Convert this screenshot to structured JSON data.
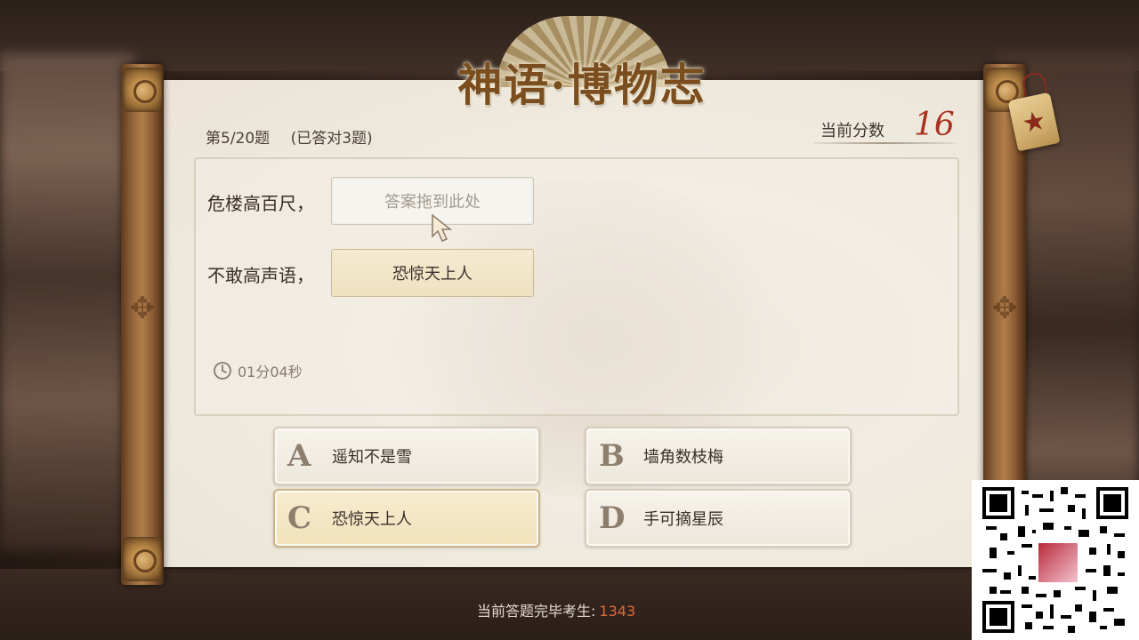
{
  "header": {
    "title": "神语·博物志",
    "progress": "第5/20题",
    "answered": "(已答对3题)",
    "score_label": "当前分数",
    "score_value": "16"
  },
  "question": {
    "line1_prefix": "危楼高百尺，",
    "line1_slot_placeholder": "答案拖到此处",
    "line2_prefix": "不敢高声语，",
    "line2_answer": "恐惊天上人",
    "timer": "01分04秒"
  },
  "options": [
    {
      "letter": "A",
      "text": "遥知不是雪"
    },
    {
      "letter": "B",
      "text": "墙角数枝梅"
    },
    {
      "letter": "C",
      "text": "恐惊天上人"
    },
    {
      "letter": "D",
      "text": "手可摘星辰"
    }
  ],
  "footer": {
    "label": "当前答题完毕考生:",
    "count": "1343"
  },
  "icons": {
    "tag": "star-tag-icon",
    "clock": "clock-icon",
    "cursor": "pointer-cursor"
  },
  "colors": {
    "score": "#a8301f",
    "footer_count": "#e06a3a",
    "title": "#7a4e1e"
  }
}
